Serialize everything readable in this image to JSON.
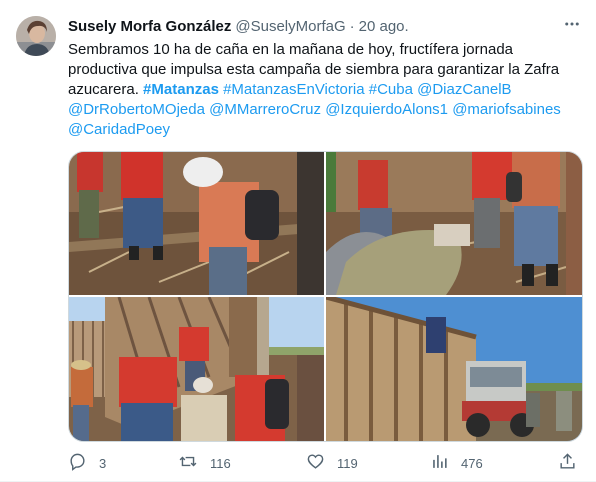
{
  "author": {
    "name": "Susely Morfa González",
    "handle": "@SuselyMorfaG",
    "separator": "·",
    "time": "20 ago."
  },
  "tweet": {
    "text_plain": "Sembramos 10 ha de caña en la mañana de hoy, fructífera jornada productiva que impulsa esta campaña de siembra para garantizar la Zafra azucarera.",
    "hashtags": [
      "#Matanzas",
      "#MatanzasEnVictoria",
      "#Cuba"
    ],
    "mentions": [
      "@DiazCanelB",
      "@DrRobertoMOjeda",
      "@MMarreroCruz",
      "@IzquierdoAlons1",
      "@mariofsabines",
      "@CaridadPoey"
    ]
  },
  "actions": {
    "replies": "3",
    "retweets": "116",
    "likes": "119",
    "views": "476"
  },
  "icons": {
    "more": "more-horizontal-icon",
    "reply": "reply-icon",
    "retweet": "retweet-icon",
    "like": "heart-icon",
    "views": "analytics-icon",
    "share": "share-icon"
  },
  "colors": {
    "link": "#1d9bf0",
    "secondary_text": "#536471",
    "primary_text": "#0f1419",
    "border": "#cfd9de"
  }
}
